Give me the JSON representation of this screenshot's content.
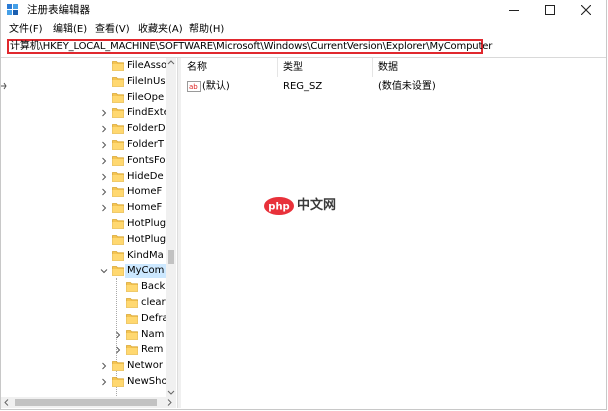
{
  "window": {
    "title": "注册表编辑器"
  },
  "menu": [
    "文件(F)",
    "编辑(E)",
    "查看(V)",
    "收藏夹(A)",
    "帮助(H)"
  ],
  "address": {
    "path": "计算机\\HKEY_LOCAL_MACHINE\\SOFTWARE\\Microsoft\\Windows\\CurrentVersion\\Explorer\\MyComputer"
  },
  "tree": [
    {
      "label": "FileAssoc",
      "expandable": false
    },
    {
      "label": "FileInUs",
      "expandable": false
    },
    {
      "label": "FileOpe",
      "expandable": false
    },
    {
      "label": "FindExte",
      "expandable": true
    },
    {
      "label": "FolderD",
      "expandable": true
    },
    {
      "label": "FolderT",
      "expandable": true
    },
    {
      "label": "FontsFo",
      "expandable": true
    },
    {
      "label": "HideDe",
      "expandable": true
    },
    {
      "label": "HomeF",
      "expandable": true
    },
    {
      "label": "HomeF",
      "expandable": true
    },
    {
      "label": "HotPlug",
      "expandable": false
    },
    {
      "label": "HotPlug",
      "expandable": false
    },
    {
      "label": "KindMa",
      "expandable": false
    },
    {
      "label": "MyCom",
      "expanded": true,
      "selected": true
    },
    {
      "label": "Back",
      "child": true
    },
    {
      "label": "clear",
      "child": true
    },
    {
      "label": "Defra",
      "child": true
    },
    {
      "label": "Nam",
      "child": true,
      "expandable": true
    },
    {
      "label": "Rem",
      "child": true,
      "expandable": true
    },
    {
      "label": "Networ",
      "expandable": true
    },
    {
      "label": "NewSho",
      "expandable": true
    }
  ],
  "list": {
    "columns": [
      "名称",
      "类型",
      "数据"
    ],
    "rows": [
      {
        "name": "(默认)",
        "type": "REG_SZ",
        "data": "(数值未设置)"
      }
    ]
  },
  "watermark": {
    "logo": "php",
    "text": "中文网"
  },
  "colors": {
    "address_border": "#e0282e",
    "folder": "#f5c451",
    "selection": "#cce8ff",
    "watermark_logo": "#e8313a"
  }
}
